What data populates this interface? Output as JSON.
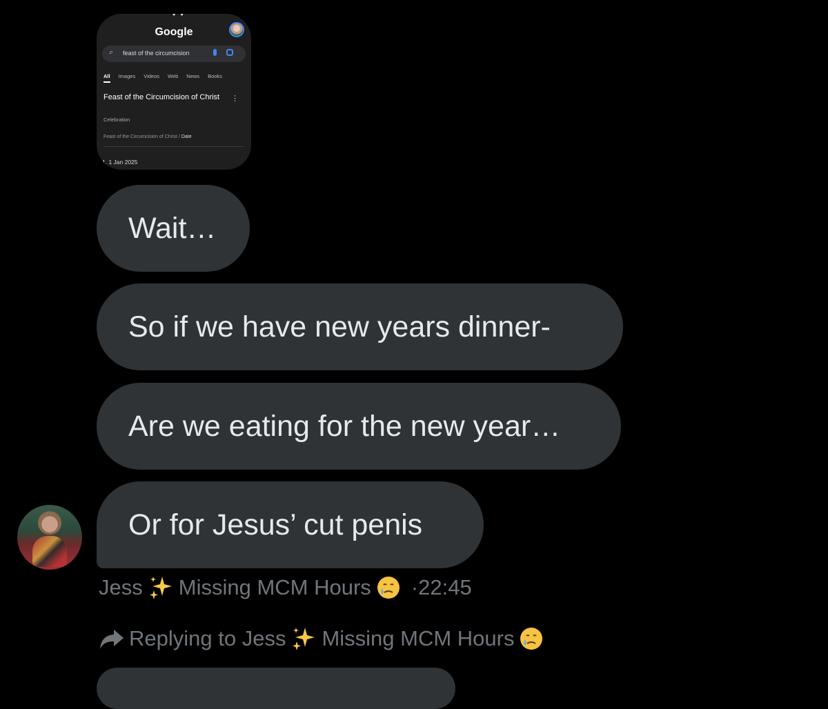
{
  "screenshot": {
    "logo": "Google",
    "search_query": "feast of the circumcision",
    "tabs": [
      "All",
      "Images",
      "Videos",
      "Web",
      "News",
      "Books"
    ],
    "result_title": "Feast of the Circumcision of Christ",
    "result_subtitle": "Celebration",
    "crumb_left": "Feast of the Circumcision of Christ",
    "crumb_sep": "/",
    "crumb_right": "Date",
    "date": "1. 1 Jan 2025"
  },
  "messages": [
    {
      "text": "Wait…"
    },
    {
      "text": "So if we have new years dinner-"
    },
    {
      "text": "Are we eating for the new year…"
    },
    {
      "text": "Or for Jesus’ cut penis"
    }
  ],
  "meta": {
    "sender_first": "Jess",
    "sender_rest": "Missing MCM Hours",
    "time": "·22:45"
  },
  "reply": {
    "prefix": "Replying to Jess",
    "name_rest": "Missing MCM Hours"
  },
  "icons": {
    "sparkles": "sparkles-emoji",
    "tear": "face-holding-back-tears-emoji",
    "reply": "reply-arrow-icon"
  }
}
